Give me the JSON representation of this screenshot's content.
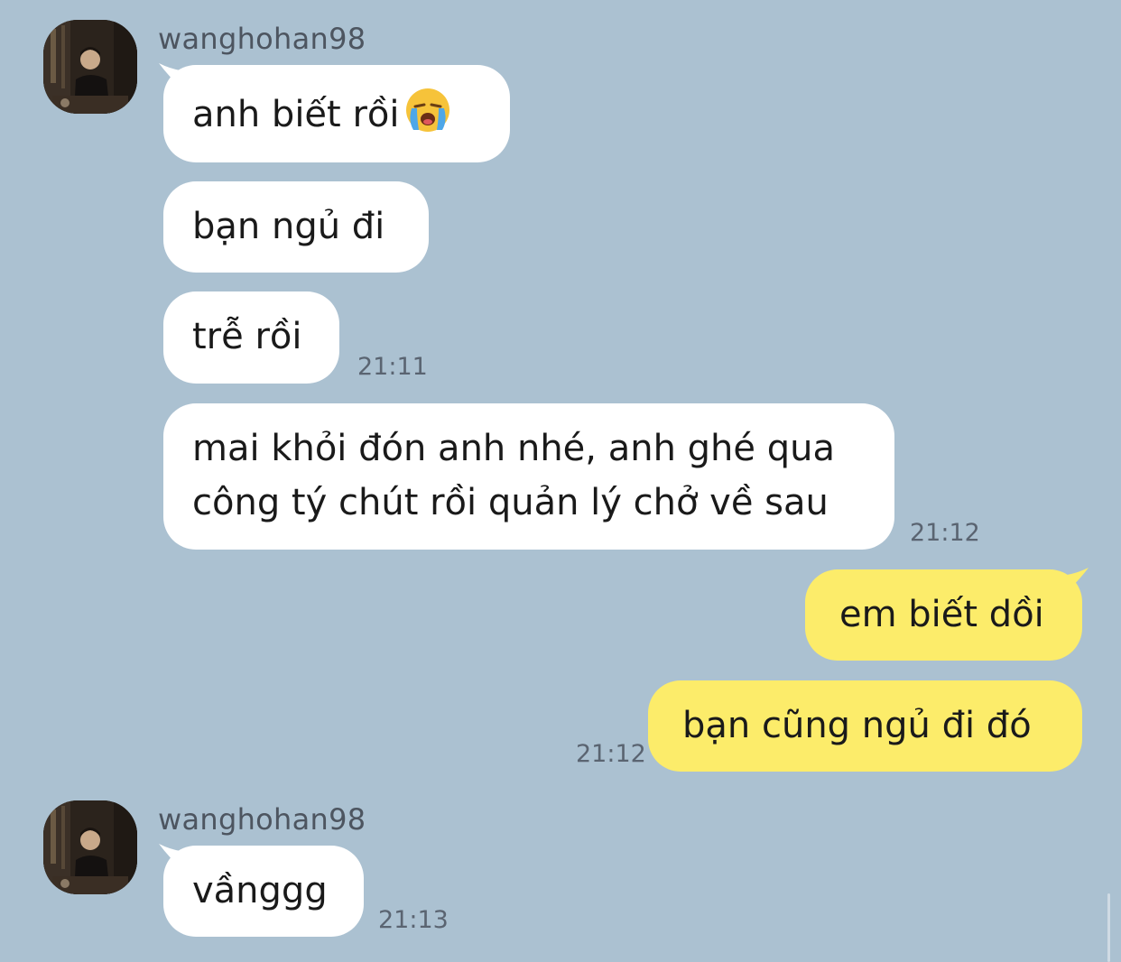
{
  "colors": {
    "background": "#abc1d1",
    "incoming_bubble": "#ffffff",
    "outgoing_bubble": "#fcec6a",
    "timestamp": "#5a6471"
  },
  "messages": {
    "group1": {
      "username": "wanghohan98",
      "m1_text": "anh biết rồi",
      "m1_emoji": "loudly-crying-face-emoji",
      "m2_text": "bạn ngủ đi",
      "m3_text": "trễ rồi",
      "m3_time": "21:11",
      "m4_line1": "mai khỏi đón anh nhé, anh ghé qua",
      "m4_line2": "công tý chút rồi quản lý chở về sau",
      "m4_time": "21:12"
    },
    "outgoing": {
      "o1_text": "em biết dồi",
      "o2_text": "bạn cũng ngủ đi đó",
      "o2_time": "21:12"
    },
    "group2": {
      "username": "wanghohan98",
      "m1_text": "vầnggg",
      "m1_time": "21:13"
    }
  }
}
